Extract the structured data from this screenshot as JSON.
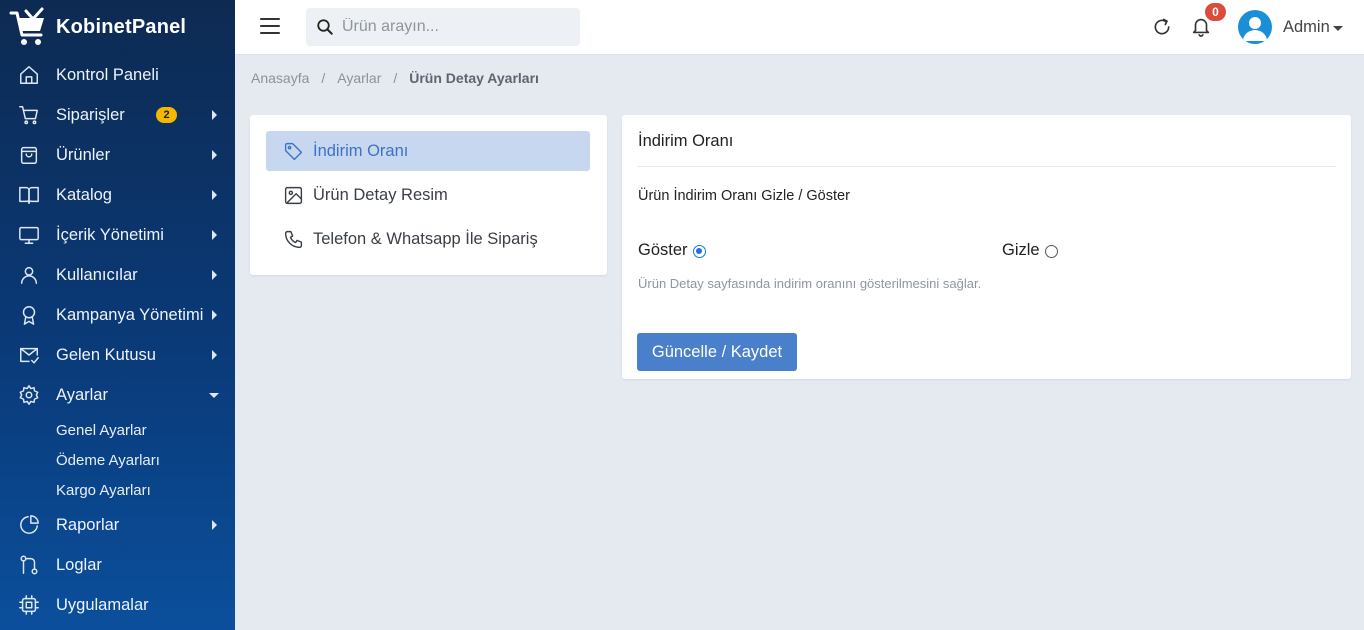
{
  "brand": {
    "name": "KobinetPanel"
  },
  "sidebar": {
    "items": [
      {
        "label": "Kontrol Paneli",
        "icon": "home-icon"
      },
      {
        "label": "Siparişler",
        "icon": "cart-icon",
        "badge": "2"
      },
      {
        "label": "Ürünler",
        "icon": "bag-icon"
      },
      {
        "label": "Katalog",
        "icon": "book-icon"
      },
      {
        "label": "İçerik Yönetimi",
        "icon": "monitor-icon"
      },
      {
        "label": "Kullanıcılar",
        "icon": "user-icon"
      },
      {
        "label": "Kampanya Yönetimi",
        "icon": "award-icon"
      },
      {
        "label": "Gelen Kutusu",
        "icon": "mail-check-icon"
      },
      {
        "label": "Ayarlar",
        "icon": "gear-icon"
      },
      {
        "label": "Raporlar",
        "icon": "pie-chart-icon"
      },
      {
        "label": "Loglar",
        "icon": "git-icon"
      },
      {
        "label": "Uygulamalar",
        "icon": "chip-icon"
      }
    ],
    "subitems": [
      "Genel Ayarlar",
      "Ödeme Ayarları",
      "Kargo Ayarları"
    ]
  },
  "topbar": {
    "search_placeholder": "Ürün arayın...",
    "notifications": "0",
    "user": "Admin"
  },
  "breadcrumb": {
    "home": "Anasayfa",
    "parent": "Ayarlar",
    "current": "Ürün Detay Ayarları",
    "sep": "/"
  },
  "tabs": [
    {
      "label": "İndirim Oranı",
      "icon": "tag-icon",
      "active": true
    },
    {
      "label": "Ürün Detay Resim",
      "icon": "image-icon",
      "active": false
    },
    {
      "label": "Telefon & Whatsapp İle Sipariş",
      "icon": "phone-icon",
      "active": false
    }
  ],
  "panel": {
    "title": "İndirim Oranı",
    "subtitle": "Ürün İndirim Oranı Gizle / Göster",
    "option_show": "Göster",
    "option_hide": "Gizle",
    "selected": "Göster",
    "help": "Ürün Detay sayfasında indirim oranını gösterilmesini sağlar.",
    "save_label": "Güncelle / Kaydet"
  },
  "colors": {
    "accent": "#4a7fcc",
    "badge": "#f5b800",
    "notification": "#dc4c3a",
    "sidebar": "#0a3a78"
  }
}
